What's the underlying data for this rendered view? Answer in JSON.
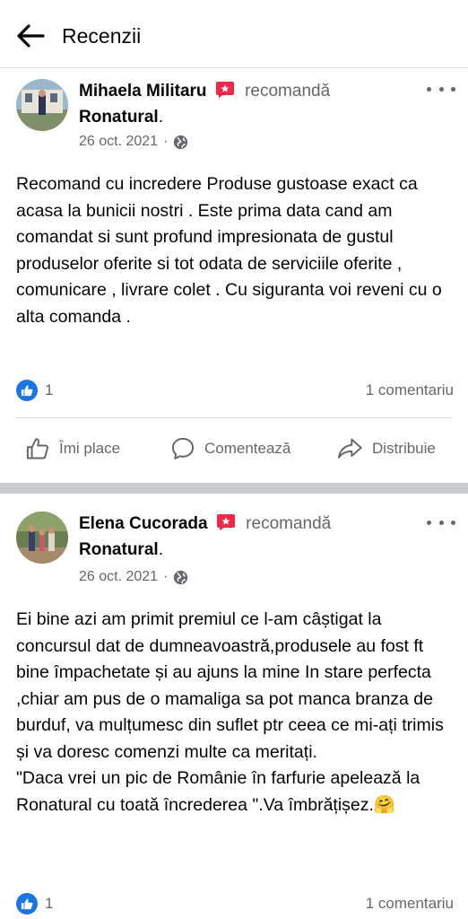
{
  "header": {
    "title": "Recenzii",
    "back_icon": "arrow-left-icon"
  },
  "colors": {
    "like_blue": "#1b74e4",
    "recommend_red": "#f02849",
    "separator": "#c9ccd1",
    "secondary_text": "#65676b"
  },
  "reviews": [
    {
      "author": "Mihaela Militaru",
      "action": "recomandă",
      "page": "Ronatural",
      "date": "26 oct. 2021",
      "privacy_icon": "globe-icon",
      "text": "Recomand cu incredere Produse gustoase exact ca acasa la bunicii nostri . Este prima data cand am comandat si sunt profund impresionata de gustul produselor oferite si tot odata de serviciile oferite , comunicare , livrare colet . Cu siguranta voi reveni cu o alta comanda .",
      "likes": "1",
      "comments": "1 comentariu",
      "actions": {
        "like": "Îmi place",
        "comment": "Comentează",
        "share": "Distribuie"
      }
    },
    {
      "author": "Elena Cucorada",
      "action": "recomandă",
      "page": "Ronatural",
      "date": "26 oct. 2021",
      "privacy_icon": "globe-icon",
      "text": "Ei bine azi am primit premiul ce l-am câștigat la concursul dat de dumneavoastră,produsele au fost ft bine împachetate și au ajuns la mine In stare perfecta ,chiar am pus de o mamaliga sa pot manca branza de burduf, va mulțumesc din suflet ptr ceea ce mi-ați trimis și va doresc comenzi multe ca meritați.\n\"Daca vrei un pic de Românie în farfurie apelează la Ronatural cu toată încrederea \".Va îmbrățișez.🤗",
      "likes": "1",
      "comments": "1 comentariu"
    }
  ]
}
